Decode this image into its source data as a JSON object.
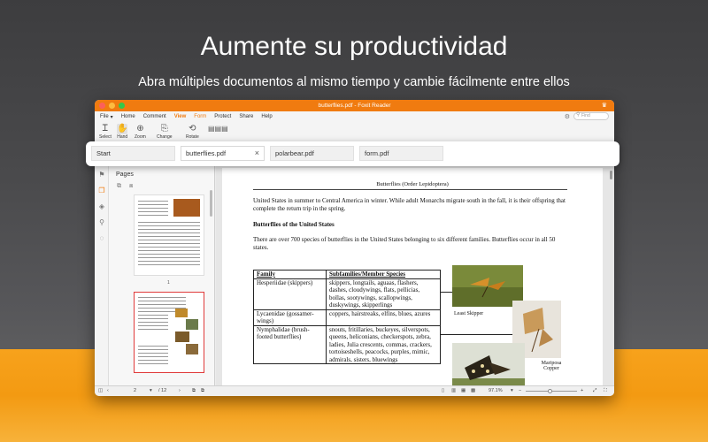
{
  "promo": {
    "headline": "Aumente su productividad",
    "subheadline": "Abra múltiples documentos al mismo tiempo y cambie fácilmente entre ellos"
  },
  "window": {
    "title": "butterflies.pdf - Foxit Reader"
  },
  "menu": {
    "file": "File",
    "items": [
      "Home",
      "Comment",
      "View",
      "Form",
      "Protect",
      "Share",
      "Help"
    ],
    "active": "View",
    "find_placeholder": "Find"
  },
  "ribbon": {
    "tools": [
      "Select",
      "Hand",
      "Zoom",
      "Change",
      "Rotate"
    ]
  },
  "tabs": [
    {
      "label": "Start"
    },
    {
      "label": "butterflies.pdf"
    },
    {
      "label": "polarbear.pdf"
    },
    {
      "label": "form.pdf"
    }
  ],
  "pages_panel": {
    "title": "Pages",
    "thumb_page_number": "1"
  },
  "document": {
    "header": "Butterflies (Order Lepidoptera)",
    "para1": "United States in summer to Central America in winter.  While adult Monarchs migrate south in the fall, it is their offspring that complete the return trip in the spring.",
    "heading": "Butterflies of the United States",
    "para2": "There are over 700 species of butterflies in the United States belonging to six different families.  Butterflies occur in all 50 states.",
    "table": {
      "headers": [
        "Family",
        "Subfamilies/Member Species"
      ],
      "rows": [
        [
          "Hesperiidae (skippers)",
          "skippers, longtails, aguaas, flashers, dashes, cloudywings, flats, pellicias, bollas, sootywings, scallopwings, duskywings, skipperlings"
        ],
        [
          "Lycaenidae (gossamer-wings)",
          "coppers, hairstreaks, elfins, blues, azures"
        ],
        [
          "Nymphalidae (brush-footed butterflies)",
          "snouts, fritillaries, buckeyes, silverspots, queens, heliconians, checkerspots, zebra, ladies, Julia crescents, commas, crackers, tortoiseshells, peacocks, purples, mimic, admirals, sisters, bluewings"
        ]
      ]
    },
    "captions": [
      "Least Skipper",
      "Mariposa Copper"
    ]
  },
  "statusbar": {
    "current_page": "2",
    "total_pages": "/ 12",
    "zoom": "97.1%"
  },
  "colors": {
    "accent": "#f07b10",
    "promo_orange": "#f7a21c"
  }
}
